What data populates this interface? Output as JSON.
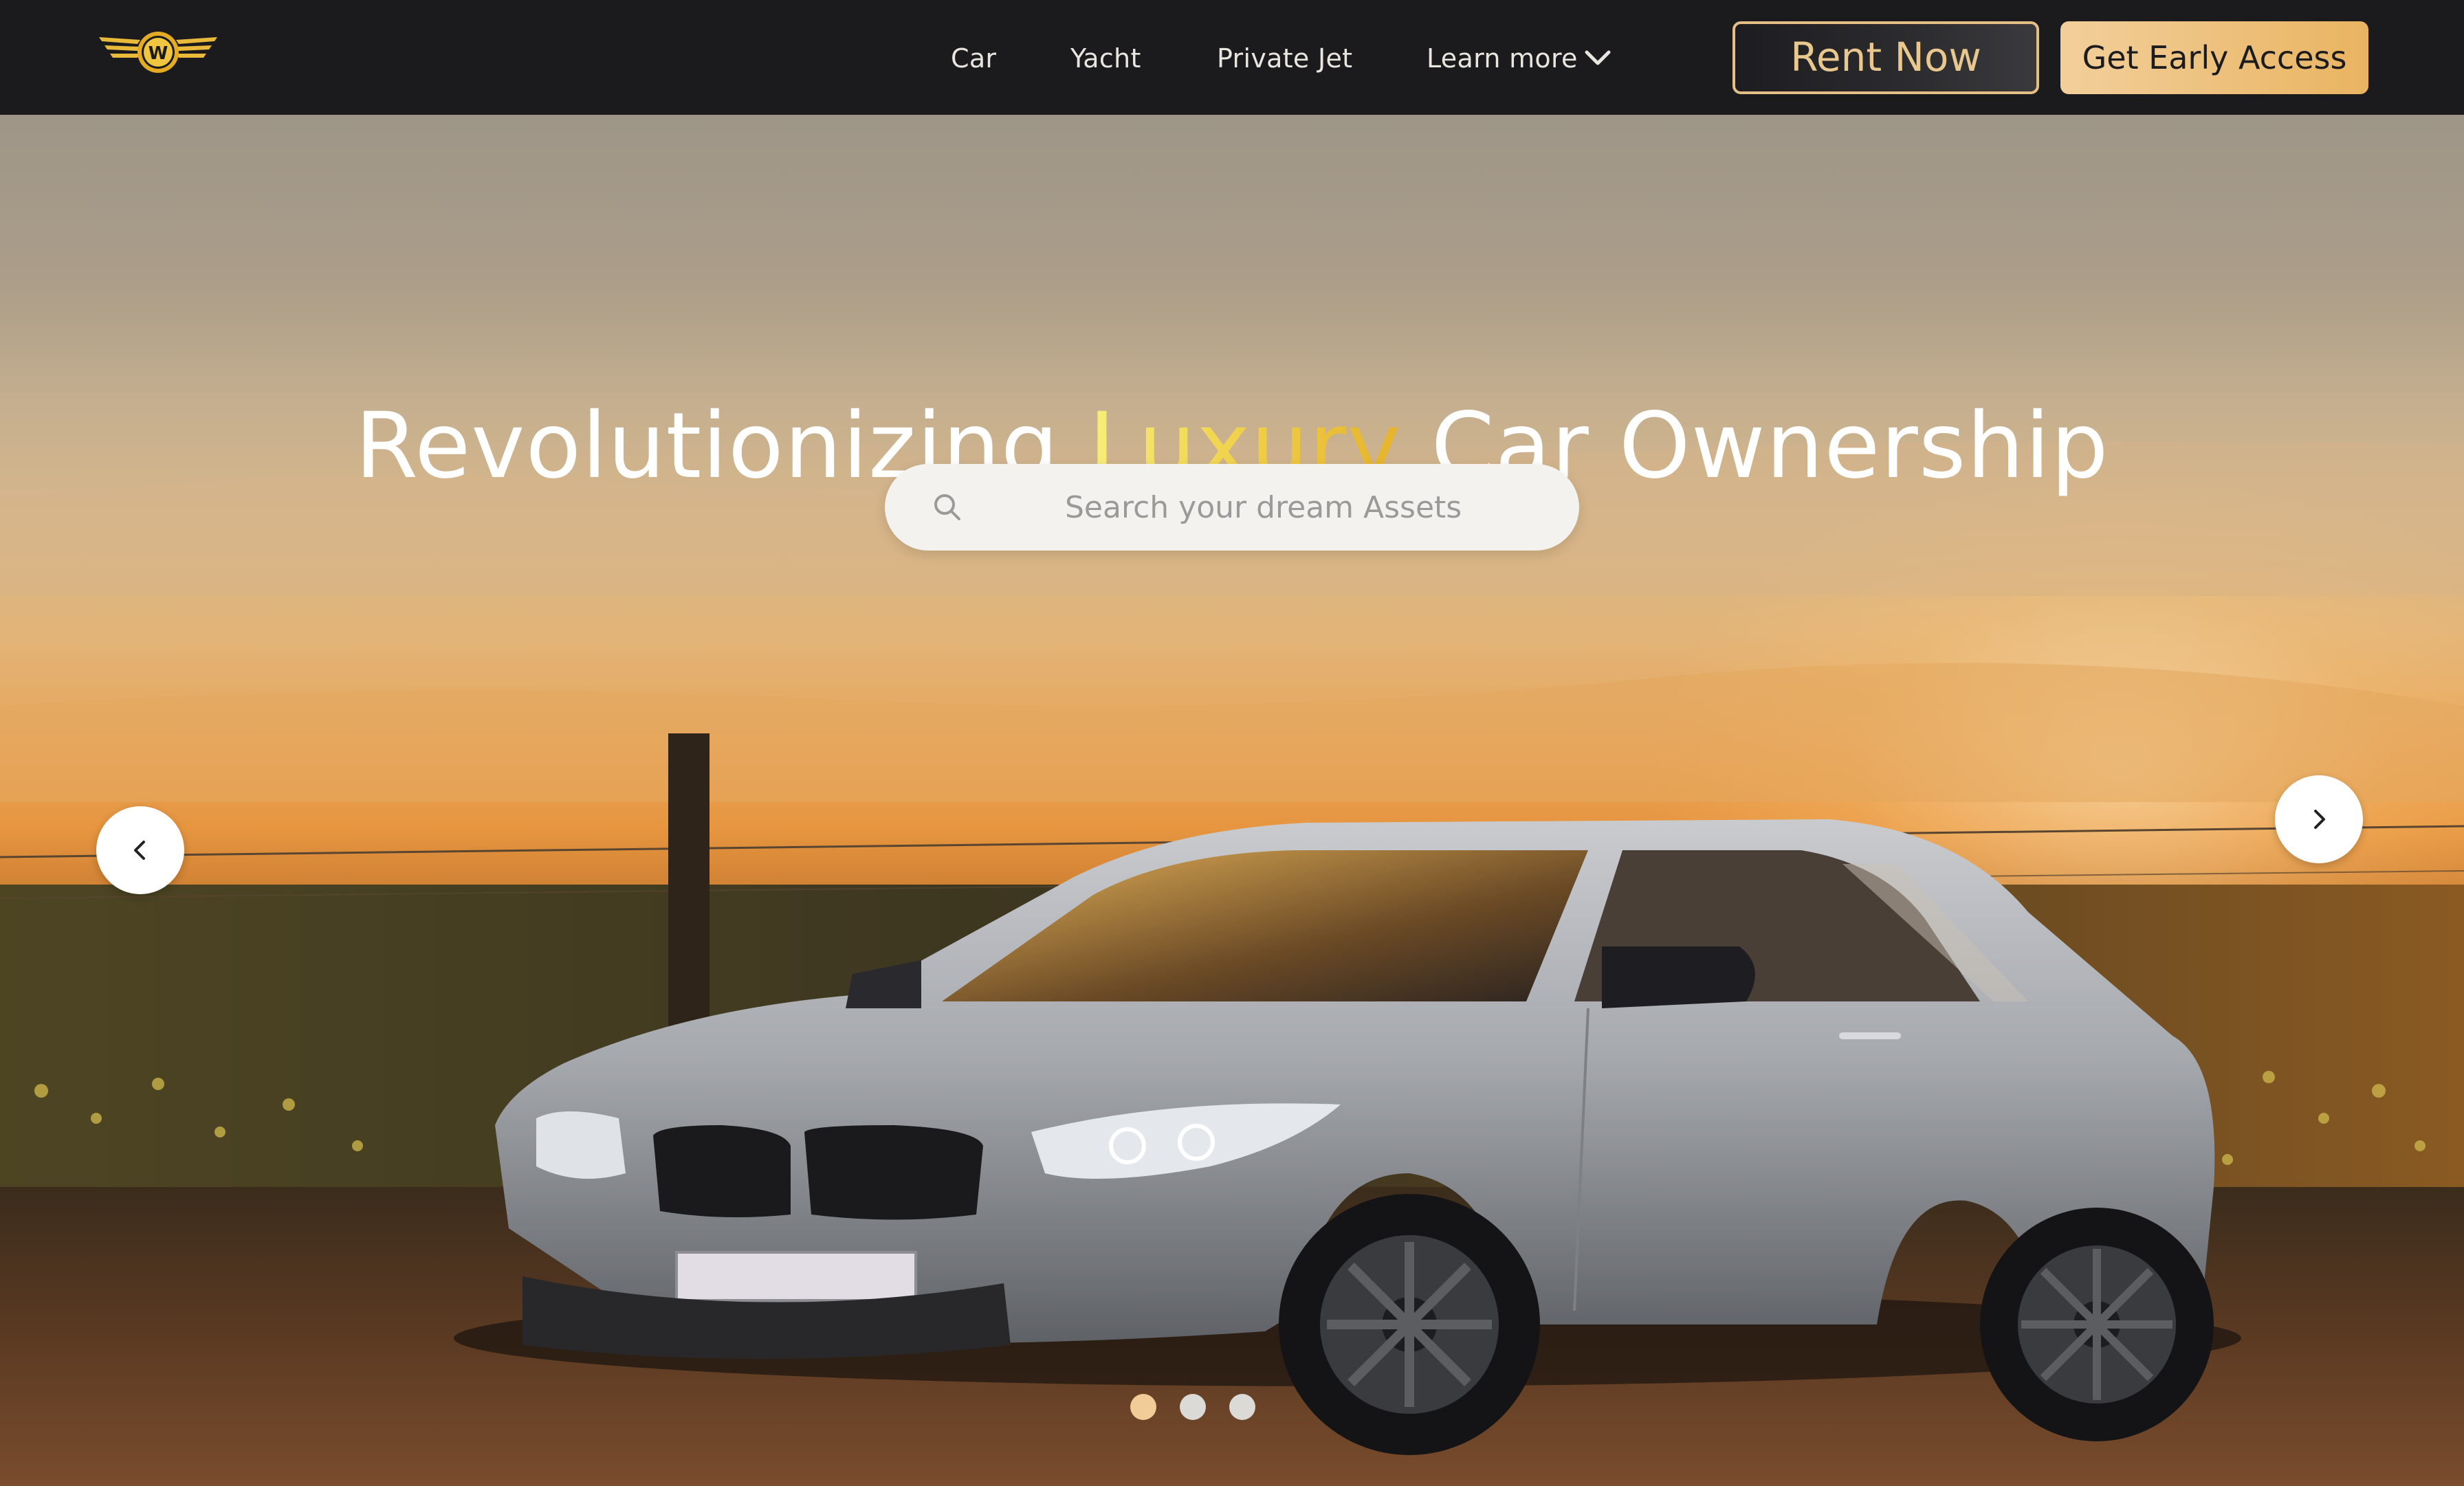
{
  "brand": {
    "logo_icon": "winged-w-emblem",
    "logo_letter": "W"
  },
  "nav": {
    "items": [
      {
        "label": "Car"
      },
      {
        "label": "Yacht"
      },
      {
        "label": "Private Jet"
      },
      {
        "label": "Learn more",
        "icon": "chevron-down-icon"
      }
    ]
  },
  "header_actions": {
    "rent_label": "Rent Now",
    "early_access_label": "Get Early Access"
  },
  "hero": {
    "title_part1": "Revolutionizing ",
    "title_accent": "Luxury",
    "title_part2": " Car Ownership",
    "search_placeholder": "Search your dream Assets",
    "prev_icon": "chevron-left-icon",
    "next_icon": "chevron-right-icon",
    "slides_total": 3,
    "active_slide": 1
  },
  "colors": {
    "nav_bg": "#1b1a1d",
    "gold_border": "#e3bf86",
    "gold_gradient_start": "#f2cf9b",
    "gold_gradient_end": "#e9b461",
    "accent_text_start": "#f6ee7a",
    "accent_text_end": "#e6b22c",
    "dot_active": "#f2cc96",
    "dot_inactive": "#dcdad6"
  }
}
